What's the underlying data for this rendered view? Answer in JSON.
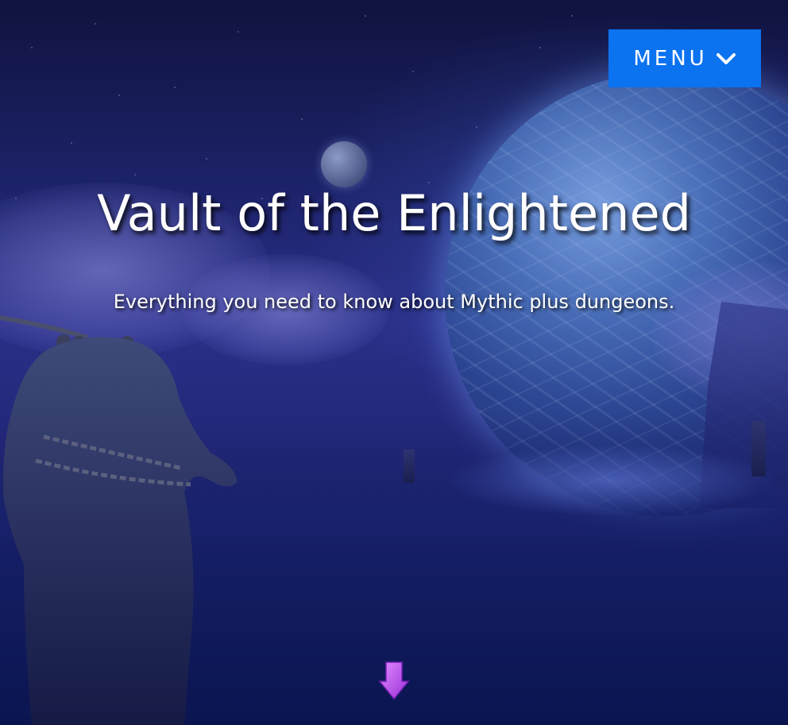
{
  "header": {
    "menu_label": "MENU",
    "menu_icon": "chevron-down-icon",
    "menu_color": "#0b72f0"
  },
  "hero": {
    "title": "Vault of the Enlightened",
    "subtitle": "Everything you need to know about Mythic plus dungeons.",
    "scroll_icon": "arrow-down-icon",
    "scroll_icon_color": "#c04bf2"
  }
}
